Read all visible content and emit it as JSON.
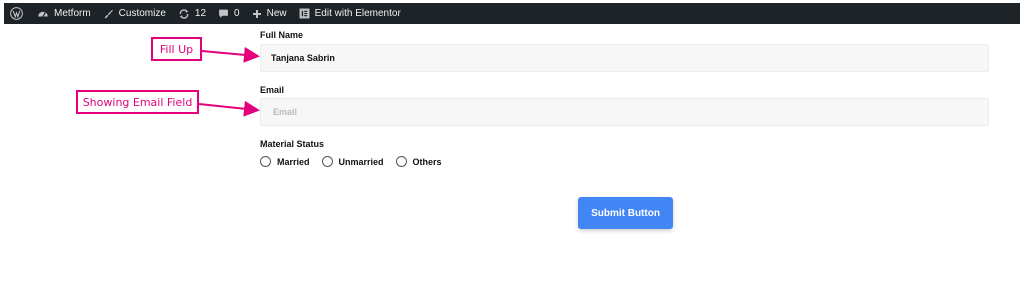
{
  "admin_bar": {
    "site_name": "Metform",
    "customize": "Customize",
    "updates_count": "12",
    "comments_count": "0",
    "new_label": "New",
    "edit_label": "Edit with Elementor"
  },
  "form": {
    "full_name_label": "Full Name",
    "full_name_value": "Tanjana Sabrin",
    "email_label": "Email",
    "email_placeholder": "Email",
    "material_status_label": "Material Status",
    "status_options": [
      "Married",
      "Unmarried",
      "Others"
    ],
    "submit_label": "Submit Button"
  },
  "annotations": {
    "fill_up": "Fill Up",
    "showing_email": "Showing Email Field"
  },
  "colors": {
    "admin_bar_bg": "#1d2327",
    "submit_bg": "#4285f4",
    "annotation": "#e4007c"
  }
}
